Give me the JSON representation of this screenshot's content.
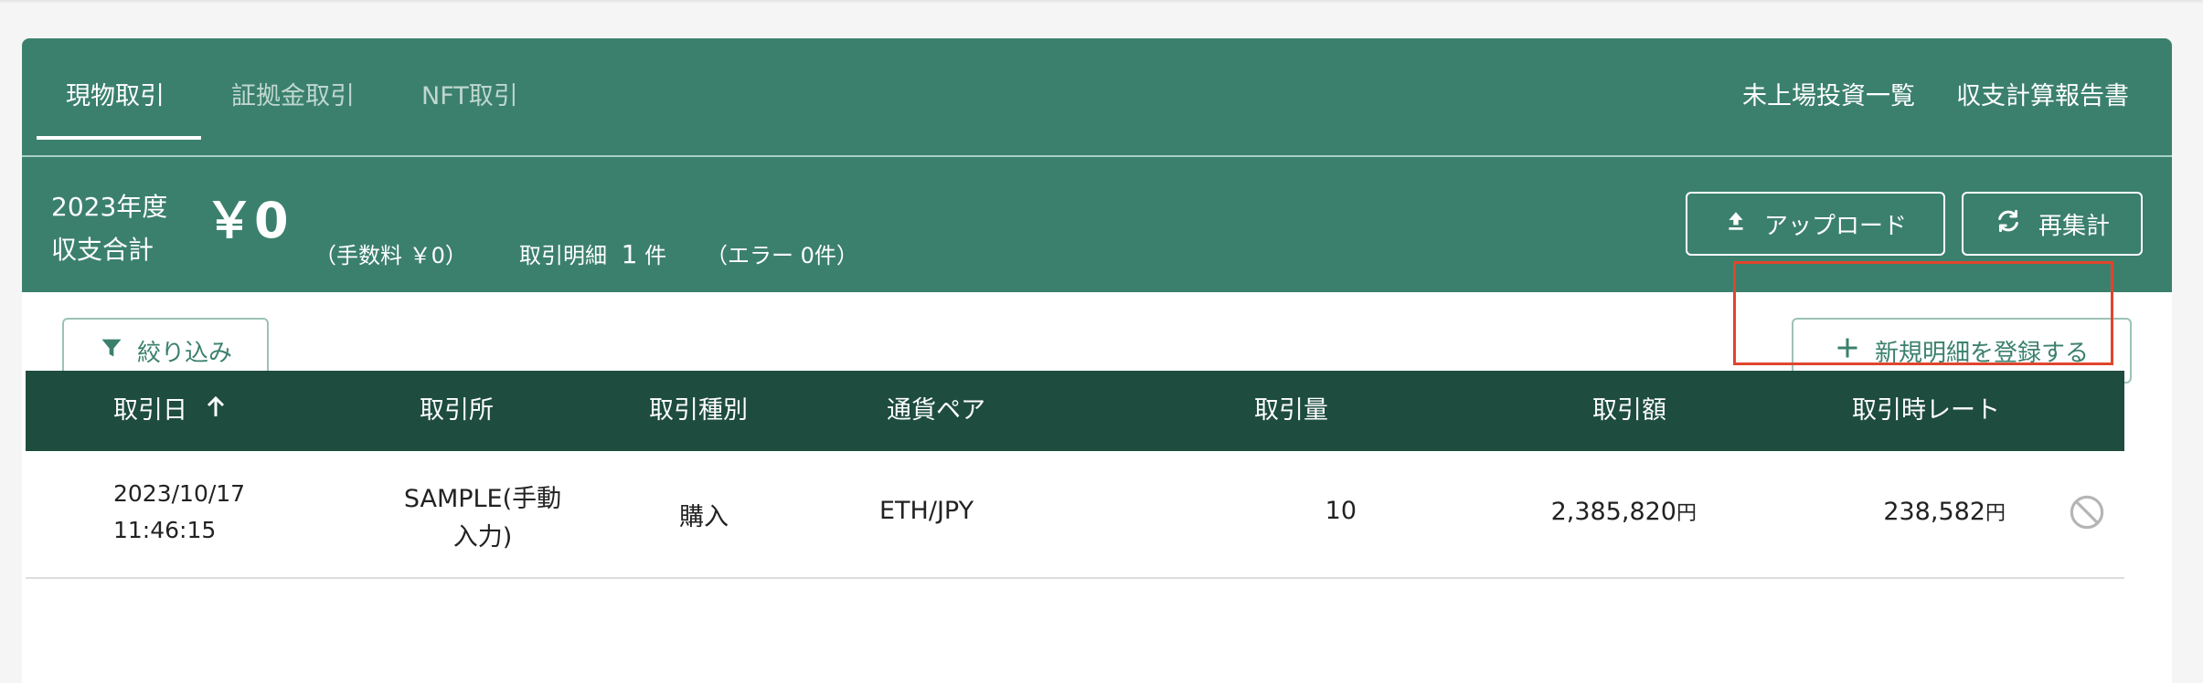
{
  "tabs": [
    {
      "label": "現物取引",
      "active": true
    },
    {
      "label": "証拠金取引",
      "active": false
    },
    {
      "label": "NFT取引",
      "active": false
    }
  ],
  "top_links": {
    "unlisted": "未上場投資一覧",
    "report": "収支計算報告書"
  },
  "summary": {
    "year_label": "2023年度",
    "total_label": "収支合計",
    "total_value": "￥0",
    "fee_text": "（手数料 ￥0）",
    "detail_label": "取引明細",
    "detail_count": "1",
    "detail_unit": "件",
    "error_text": "（エラー 0件）"
  },
  "buttons": {
    "upload": "アップロード",
    "recalc": "再集計",
    "filter": "絞り込み",
    "new_entry": "新規明細を登録する"
  },
  "table": {
    "headers": [
      "取引日",
      "取引所",
      "取引種別",
      "通貨ペア",
      "取引量",
      "取引額",
      "取引時レート"
    ],
    "rows": [
      {
        "date": "2023/10/17",
        "time": "11:46:15",
        "exchange_line1": "SAMPLE(手動",
        "exchange_line2": "入力)",
        "type": "購入",
        "pair": "ETH/JPY",
        "amount": "10",
        "value": "2,385,820",
        "rate": "238,582",
        "currency_unit": "円"
      }
    ]
  },
  "colors": {
    "brand": "#3b806d",
    "header_dark": "#1e4c3f",
    "highlight": "#e0452d"
  },
  "icons": [
    "upload-icon",
    "refresh-icon",
    "filter-icon",
    "plus-icon",
    "sort-arrow-up-icon",
    "disabled-icon"
  ]
}
